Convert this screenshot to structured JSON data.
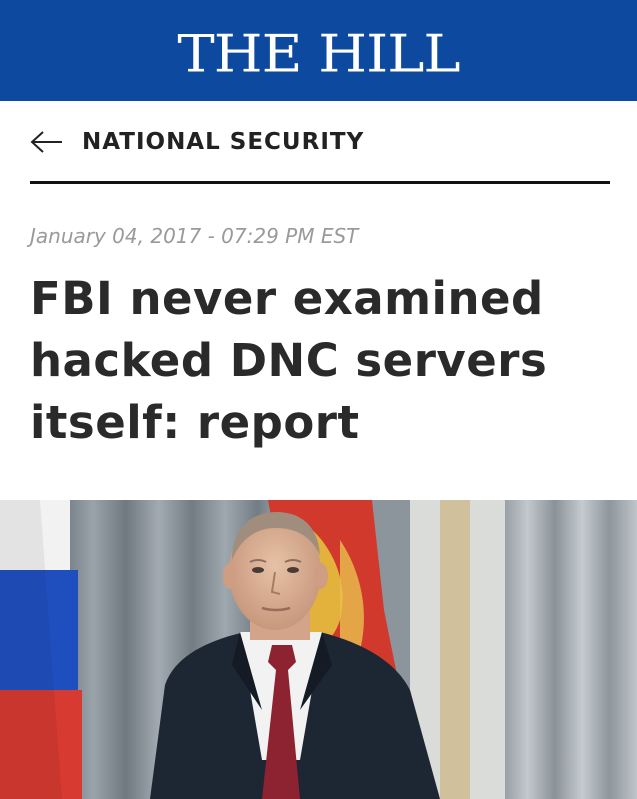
{
  "masthead": {
    "logo_text": "THE HILL",
    "background_color": "#0d4a9f"
  },
  "section": {
    "back_icon": "arrow-left-icon",
    "label": "NATIONAL SECURITY"
  },
  "article": {
    "timestamp": "January 04, 2017 - 07:29 PM EST",
    "headline": "FBI never examined hacked DNC servers itself: report",
    "hero_image": "photo-man-in-suit-with-flags"
  }
}
